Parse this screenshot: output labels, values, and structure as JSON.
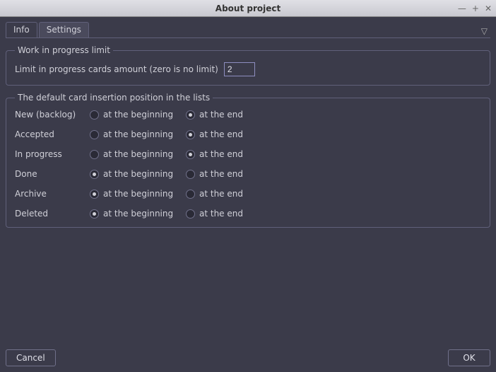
{
  "window": {
    "title": "About project"
  },
  "tabs": {
    "info": "Info",
    "settings": "Settings"
  },
  "wip": {
    "legend": "Work in progress limit",
    "label": "Limit in progress cards amount (zero is no limit)",
    "value": "2"
  },
  "defaults": {
    "legend": "The default card insertion position in the lists",
    "opt_begin": "at the beginning",
    "opt_end": "at the end",
    "rows": [
      {
        "name": "New (backlog)",
        "selected": "end"
      },
      {
        "name": "Accepted",
        "selected": "end"
      },
      {
        "name": "In progress",
        "selected": "end"
      },
      {
        "name": "Done",
        "selected": "begin"
      },
      {
        "name": "Archive",
        "selected": "begin"
      },
      {
        "name": "Deleted",
        "selected": "begin"
      }
    ]
  },
  "buttons": {
    "cancel": "Cancel",
    "ok": "OK"
  }
}
